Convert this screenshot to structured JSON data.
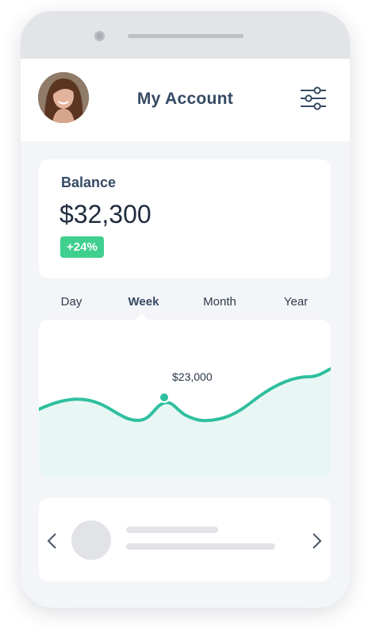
{
  "header": {
    "title": "My Account"
  },
  "balance": {
    "label": "Balance",
    "amount": "$32,300",
    "change": "+24%"
  },
  "tabs": [
    {
      "label": "Day",
      "active": false
    },
    {
      "label": "Week",
      "active": true
    },
    {
      "label": "Month",
      "active": false
    },
    {
      "label": "Year",
      "active": false
    }
  ],
  "chart": {
    "highlight_label": "$23,000"
  },
  "colors": {
    "accent": "#2fbf9f",
    "fill": "#e9f7f4",
    "badge": "#3fcf8e",
    "title": "#354a63",
    "frame": "#e3e4e8"
  },
  "icons": {
    "settings": "sliders-icon",
    "prev": "chevron-left-icon",
    "next": "chevron-right-icon"
  }
}
